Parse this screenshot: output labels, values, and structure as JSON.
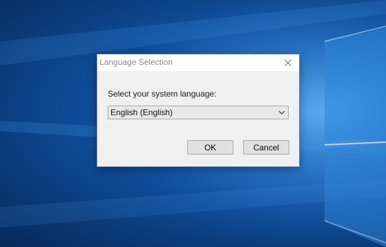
{
  "dialog": {
    "title": "Language Selection",
    "prompt": "Select your system language:",
    "language_select": {
      "selected": "English (English)"
    },
    "ok_label": "OK",
    "cancel_label": "Cancel"
  },
  "icons": {
    "close": "close-icon",
    "dropdown": "chevron-down-icon"
  },
  "colors": {
    "dialog_background": "#f0f0f0",
    "titlebar_background": "#ffffff",
    "title_text": "#8a8a8a",
    "desktop_blue": "#1f6cc2"
  }
}
